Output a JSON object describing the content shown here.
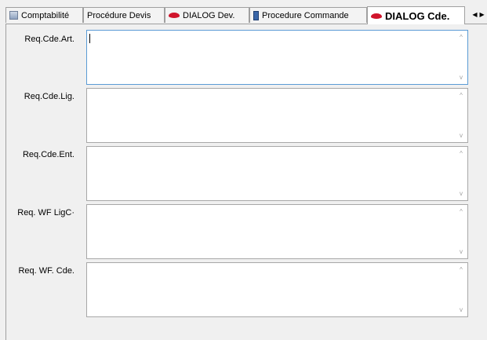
{
  "tabs": [
    {
      "label": "Comptabilité",
      "icon": "document-icon",
      "active": false
    },
    {
      "label": "Procédure Devis",
      "icon": "",
      "active": false
    },
    {
      "label": "DIALOG Dev.",
      "icon": "lips-icon",
      "active": false
    },
    {
      "label": "Procedure Commande",
      "icon": "phone-icon",
      "active": false
    },
    {
      "label": "DIALOG Cde.",
      "icon": "lips-icon",
      "active": true
    }
  ],
  "tab_scroll": {
    "left": "◀",
    "right": "▶"
  },
  "fields": [
    {
      "label": "Req.Cde.Art.",
      "value": "",
      "focused": true
    },
    {
      "label": "Req.Cde.Lig.",
      "value": "",
      "focused": false
    },
    {
      "label": "Req.Cde.Ent.",
      "value": "",
      "focused": false
    },
    {
      "label": "Req. WF LigC·",
      "value": "",
      "focused": false
    },
    {
      "label": "Req. WF. Cde.",
      "value": "",
      "focused": false
    }
  ],
  "scroll_arrows": {
    "up": "^",
    "down": "v"
  },
  "colors": {
    "accent_focus": "#5b9bd5",
    "lips": "#d0142b",
    "window_bg": "#f0f0f0"
  }
}
